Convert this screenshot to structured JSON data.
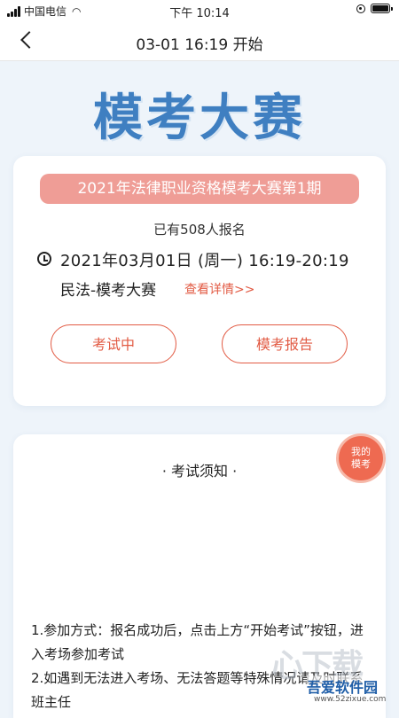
{
  "status_bar": {
    "carrier": "中国电信",
    "time": "下午 10:14"
  },
  "nav": {
    "title": "03-01 16:19 开始"
  },
  "hero": {
    "title": "模考大赛"
  },
  "exam_card": {
    "banner": "2021年法律职业资格模考大赛第1期",
    "registered": "已有508人报名",
    "datetime": "2021年03月01日 (周一)  16:19-20:19",
    "subject": "民法-模考大赛",
    "detail_link": "查看详情>>",
    "button_left": "考试中",
    "button_right": "模考报告"
  },
  "notice": {
    "title": "· 考试须知 ·",
    "rule1": "1.参加方式：报名成功后，点击上方“开始考试”按钮，进入考场参加考试",
    "rule2": "2.如遇到无法进入考场、无法答题等特殊情况请及时联系班主任"
  },
  "float_badge": {
    "label": "我的模考"
  },
  "watermark": {
    "big": "心下载",
    "brand": "吾爱软件园",
    "url": "www.52zixue.com"
  },
  "colors": {
    "accent": "#e25b44",
    "hero_blue": "#3f7fc1",
    "banner_pink": "#ef9d96",
    "page_bg": "#eef4fa"
  }
}
